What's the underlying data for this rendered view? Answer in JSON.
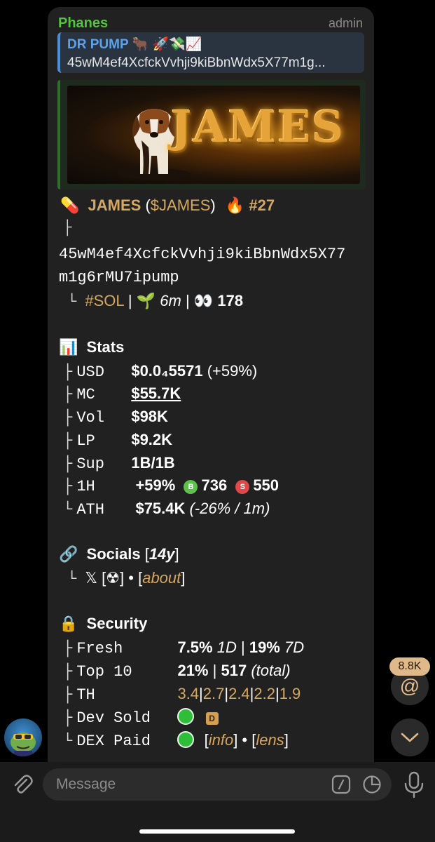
{
  "message": {
    "sender": "Phanes",
    "role": "admin",
    "reply": {
      "title": "DR PUMP 🐂 🚀💸📈",
      "text": "45wM4ef4XcfckVvhji9kiBbnWdx5X77m1g..."
    },
    "banner": {
      "word": "JAMES"
    },
    "token": {
      "emoji": "💊",
      "name": "JAMES",
      "paren_open": " (",
      "symbol": "$JAMES",
      "paren_close": ")",
      "fire": "🔥",
      "rank": "#27",
      "tree_branch": "├",
      "address_line1": "45wM4ef4XcfckVvhji9kiBbnWdx5X77",
      "address_line2": "m1g6rMU7ipump",
      "tree_end": "└",
      "chain": "#SOL",
      "sep": "|",
      "age_emoji": "🌱",
      "age": "6m",
      "holders_emoji": "👀",
      "holders": "178"
    },
    "stats": {
      "emoji": "📊",
      "title": "Stats",
      "rows": [
        {
          "prefix": "├",
          "label": "USD",
          "value": "$0.0₄5571",
          "extra": "(+59%)"
        },
        {
          "prefix": "├",
          "label": "MC",
          "value": "$55.7K",
          "extra": ""
        },
        {
          "prefix": "├",
          "label": "Vol",
          "value": "$98K",
          "extra": ""
        },
        {
          "prefix": "├",
          "label": "LP",
          "value": "$9.2K",
          "extra": ""
        },
        {
          "prefix": "├",
          "label": "Sup",
          "value": "1B/1B",
          "extra": ""
        }
      ],
      "h1": {
        "prefix": "├",
        "label": "1H",
        "change": "+59%",
        "buy_badge": "B",
        "buys": "736",
        "sell_badge": "S",
        "sells": "550"
      },
      "ath": {
        "prefix": "└",
        "label": "ATH",
        "value": "$75.4K",
        "extra": "(-26% / 1m)"
      }
    },
    "socials": {
      "emoji": "🔗",
      "title": "Socials",
      "bracket_open": " [",
      "age": "14y",
      "bracket_close": "]",
      "prefix": "└",
      "x_icon": "𝕏",
      "link_open": " [",
      "link_icon": "☢",
      "link_close": "]",
      "dot": " • [",
      "about": "about",
      "about_close": "]"
    },
    "security": {
      "emoji": "🔒",
      "title": "Security",
      "fresh": {
        "prefix": "├",
        "label": "Fresh",
        "v1": "7.5%",
        "p1": "1D",
        "sep": "|",
        "v2": "19%",
        "p2": "7D"
      },
      "top10": {
        "prefix": "├",
        "label": "Top 10",
        "v1": "21%",
        "sep": "|",
        "v2": "517",
        "note": "(total)"
      },
      "th": {
        "prefix": "├",
        "label": "TH",
        "values": [
          "3.4",
          "2.7",
          "2.4",
          "2.2",
          "1.9"
        ],
        "sep": "|"
      },
      "dev_sold": {
        "prefix": "├",
        "label": "Dev Sold",
        "badge": "D"
      },
      "dex_paid": {
        "prefix": "└",
        "label": "DEX Paid",
        "open": "[",
        "info": "info",
        "mid": "] • [",
        "lens": "lens",
        "close": "]"
      }
    }
  },
  "floating": {
    "mention_count": "8.8K",
    "mention_symbol": "@"
  },
  "composer": {
    "placeholder": "Message"
  }
}
